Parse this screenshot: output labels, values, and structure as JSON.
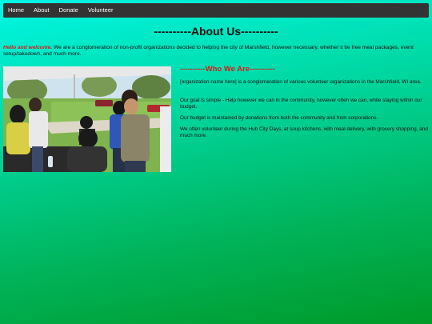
{
  "nav": [
    "Home",
    "About",
    "Donate",
    "Volunteer"
  ],
  "page_title": "----------About Us----------",
  "intro": {
    "hello": "Hello and welcome.",
    "text": " We are a conglomeration of non-profit organizations decided to helping the city of Marshfield, however necessary, whether it be free meal packages, event setup/takedown, and much more."
  },
  "photo": {
    "alt": "volunteers photo"
  },
  "who": {
    "title": "----------Who We Are----------",
    "paragraphs": [
      "[organization name here] is a conglomeration of various volunteer organizations in the Marshfield, WI area.",
      "Our goal is simple - Help however we can in the community, however often we can, while staying within our budget.",
      "Our budget is maintained by donations from both the community and from corporations.",
      "We often volunteer during the Hub City Days, at soup kitchens, with meal delivery, with grocery shopping, and much more."
    ]
  }
}
